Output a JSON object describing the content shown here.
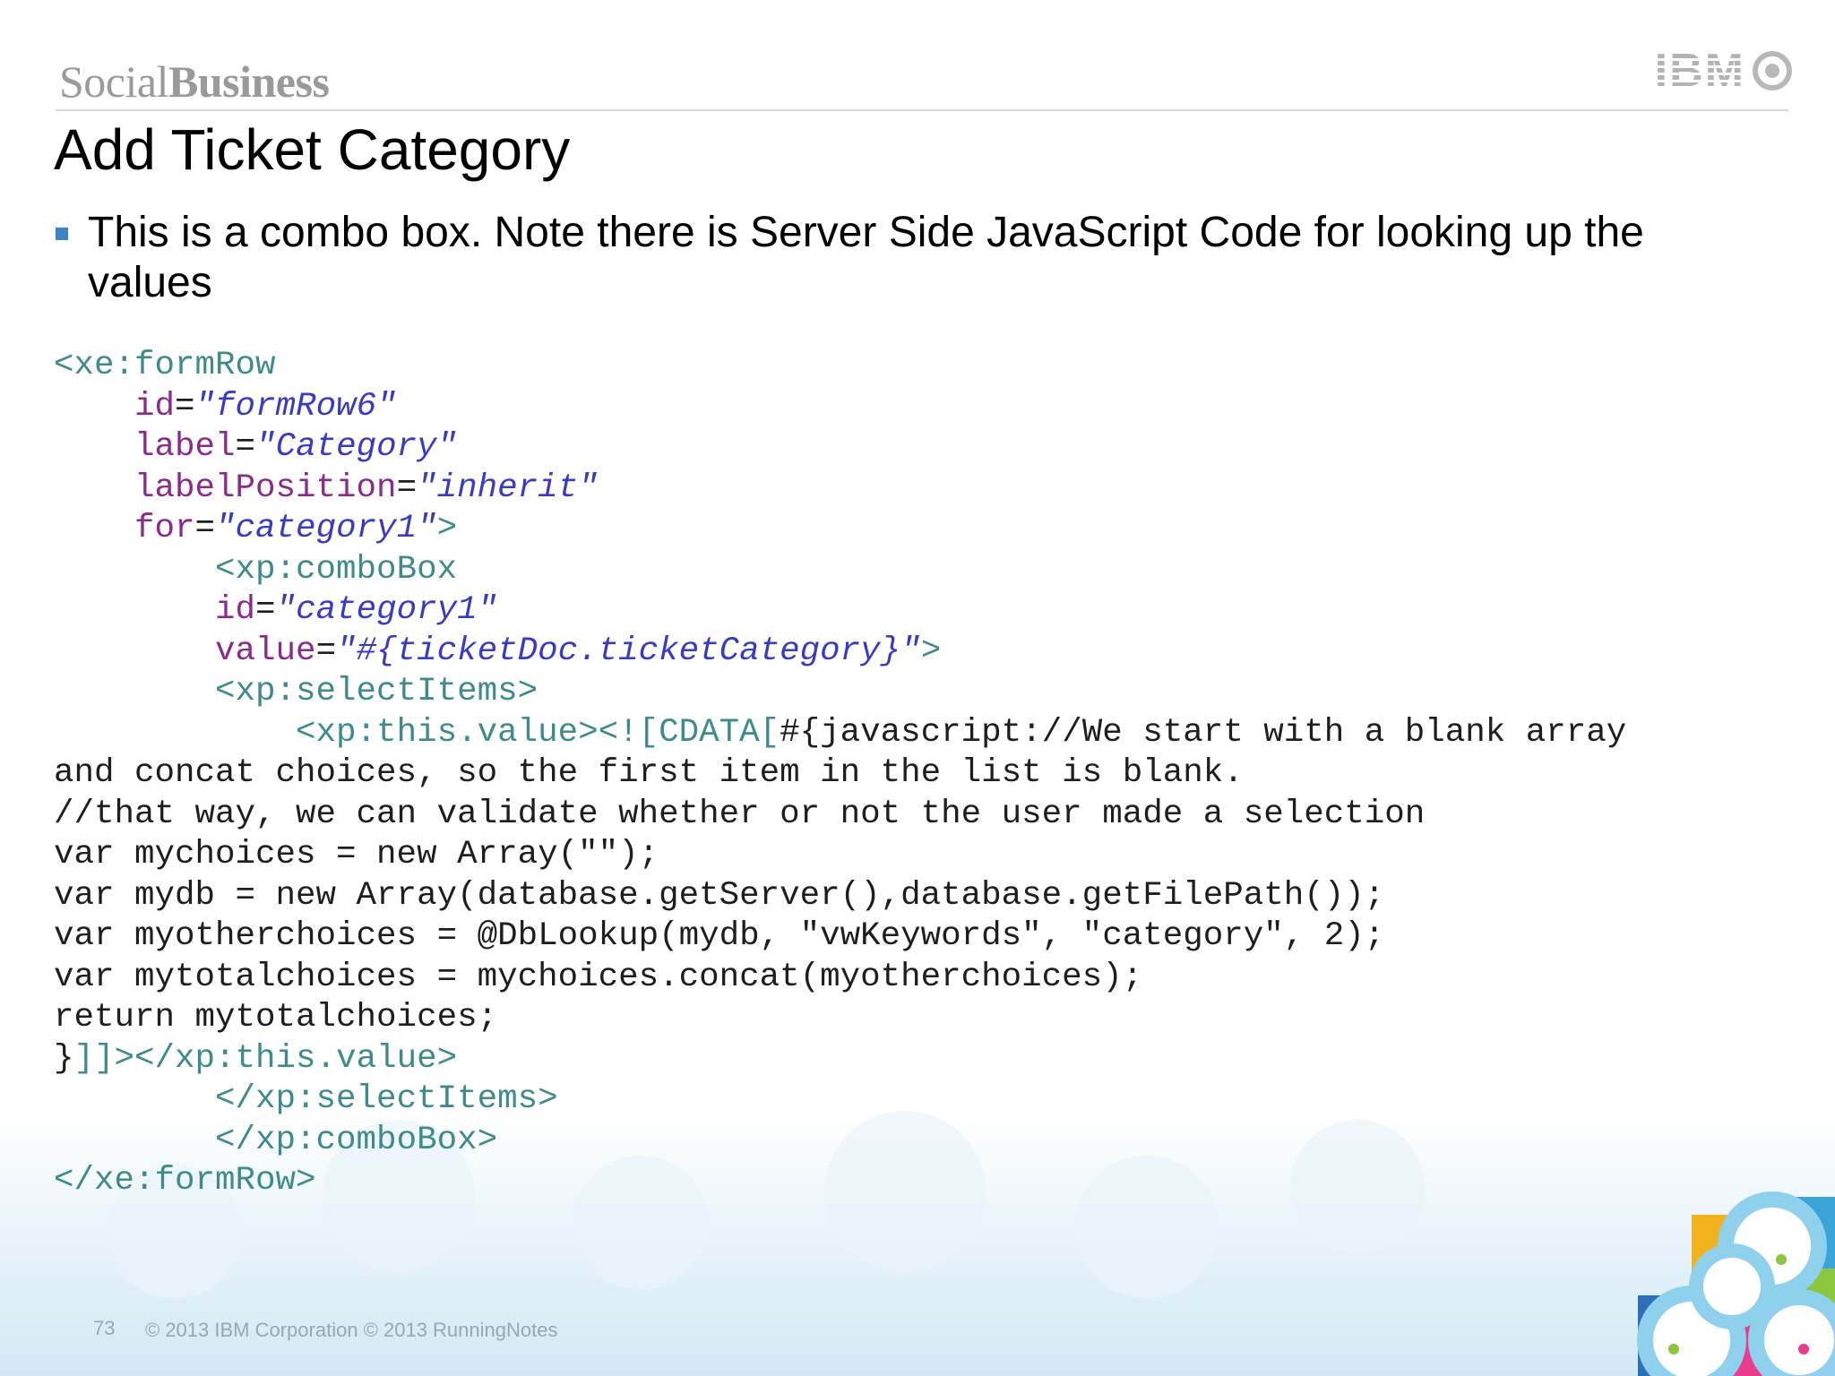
{
  "header": {
    "brand_light": "Social",
    "brand_bold": "Business",
    "logo_text": "IBM"
  },
  "slide": {
    "title": "Add Ticket Category",
    "bullet": "This is a combo box.  Note there is Server Side JavaScript Code for looking up the values"
  },
  "code": {
    "l1_tag": "<xe:formRow",
    "l2_attr": "id",
    "l2_eq": "=",
    "l2_val": "\"formRow6\"",
    "l3_attr": "label",
    "l3_eq": "=",
    "l3_val": "\"Category\"",
    "l4_attr": "labelPosition",
    "l4_eq": "=",
    "l4_val": "\"inherit\"",
    "l5_attr": "for",
    "l5_eq": "=",
    "l5_val": "\"category1\"",
    "l5_end": ">",
    "l6_tag": "<xp:comboBox",
    "l7_attr": "id",
    "l7_eq": "=",
    "l7_val": "\"category1\"",
    "l8_attr": "value",
    "l8_eq": "=",
    "l8_val": "\"#{ticketDoc.ticketCategory}\"",
    "l8_end": ">",
    "l9_tag": "<xp:selectItems>",
    "l10_tag": "<xp:this.value><![CDATA[",
    "l10_js": "#{javascript://We start with a blank array",
    "l11": "and concat choices, so the first item in the list is blank.",
    "l12": "//that way, we can validate whether or not the user made a selection",
    "l13": "var mychoices = new Array(\"\");",
    "l14": "var mydb = new Array(database.getServer(),database.getFilePath());",
    "l15": "var myotherchoices = @DbLookup(mydb, \"vwKeywords\", \"category\", 2);",
    "l16": "var mytotalchoices = mychoices.concat(myotherchoices);",
    "l17": "return mytotalchoices;",
    "l18_js": "}",
    "l18_tag": "]]></xp:this.value>",
    "l19_tag": "</xp:selectItems>",
    "l20_tag": "</xp:comboBox>",
    "l21_tag": "</xe:formRow>"
  },
  "footer": {
    "page_number": "73",
    "copyright": "© 2013 IBM Corporation  © 2013 RunningNotes"
  },
  "colors": {
    "bullet": "#3a85c4",
    "code_tag": "#3f8a8a",
    "code_attr": "#8a2a8a",
    "code_string": "#3a3ac4"
  }
}
